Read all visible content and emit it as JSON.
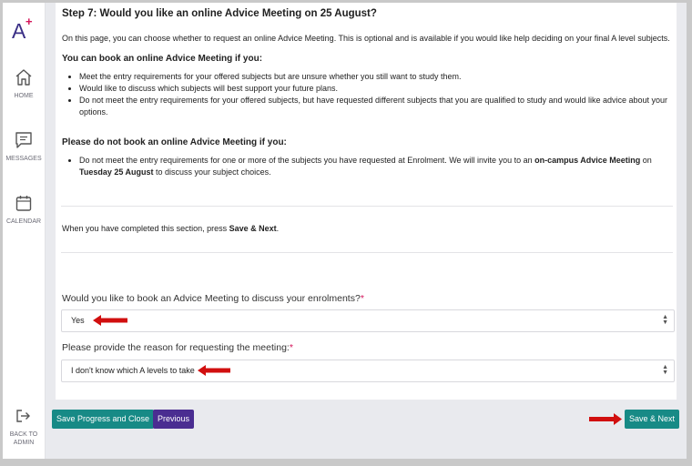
{
  "sidebar": {
    "logo": "A",
    "logo_plus": "+",
    "items": [
      {
        "label": "HOME",
        "icon": "home-icon"
      },
      {
        "label": "MESSAGES",
        "icon": "message-icon"
      },
      {
        "label": "CALENDAR",
        "icon": "calendar-icon"
      }
    ],
    "back": {
      "line1": "BACK TO",
      "line2": "ADMIN",
      "icon": "sign-out-icon"
    }
  },
  "step": {
    "title": "Step 7: Would you like an online Advice Meeting on 25 August?",
    "intro": "On this page, you can choose whether to request an online Advice Meeting. This is optional and is available if you would like help deciding on your final A level subjects.",
    "can_book_heading": "You can book an online Advice Meeting if you:",
    "can_book_items": [
      "Meet the entry requirements for your offered subjects but are unsure whether you still want to study them.",
      "Would like to discuss which subjects will best support your future plans.",
      "Do not meet the entry requirements for your offered subjects, but have requested different subjects that you are qualified to study and would like advice about your options."
    ],
    "dont_book_heading": "Please do not book an online Advice Meeting if you:",
    "dont_book_item": {
      "part1": "Do not meet the entry requirements for one or more of the subjects you have requested at Enrolment. We will invite you to an ",
      "bold1": "on-campus Advice Meeting",
      "part2": " on ",
      "bold2": "Tuesday 25 August",
      "part3": " to discuss your subject choices."
    },
    "completed": {
      "part1": "When you have completed this section, press ",
      "bold": "Save & Next",
      "part2": "."
    }
  },
  "form": {
    "q1": {
      "label": "Would you like to book an Advice Meeting to discuss your enrolments?",
      "required": "*",
      "value": "Yes"
    },
    "q2": {
      "label": "Please provide the reason for requesting the meeting:",
      "required": "*",
      "value": "I don't know which A levels to take"
    }
  },
  "buttons": {
    "save_close": "Save Progress and Close",
    "previous": "Previous",
    "save_next": "Save & Next"
  },
  "colors": {
    "teal": "#178a86",
    "purple": "#4a2d91",
    "annotation_arrow": "#d10f0f",
    "required": "#d4145a"
  }
}
